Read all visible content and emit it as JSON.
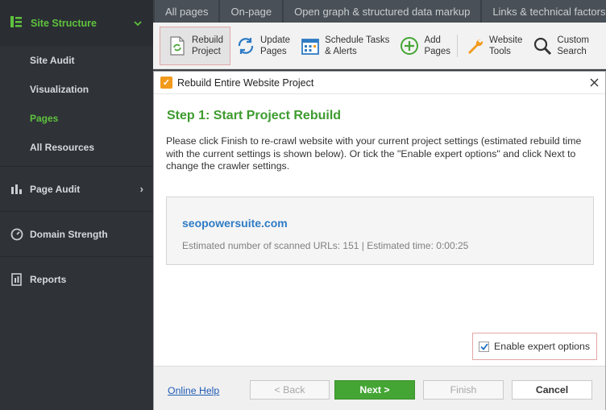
{
  "sidebar": {
    "header": {
      "label": "Site Structure",
      "icon": "site-structure-icon"
    },
    "sub_items": [
      {
        "label": "Site Audit",
        "active": false
      },
      {
        "label": "Visualization",
        "active": false
      },
      {
        "label": "Pages",
        "active": true
      },
      {
        "label": "All Resources",
        "active": false
      }
    ],
    "sections": [
      {
        "label": "Page Audit",
        "icon": "page-audit-icon",
        "has_arrow": true
      },
      {
        "label": "Domain Strength",
        "icon": "gauge-icon",
        "has_arrow": false
      },
      {
        "label": "Reports",
        "icon": "reports-icon",
        "has_arrow": false
      }
    ]
  },
  "tabs": [
    {
      "label": "All pages"
    },
    {
      "label": "On-page"
    },
    {
      "label": "Open graph & structured data markup"
    },
    {
      "label": "Links & technical factors"
    }
  ],
  "toolbar": {
    "rebuild": {
      "line1": "Rebuild",
      "line2": "Project"
    },
    "update": {
      "line1": "Update",
      "line2": "Pages"
    },
    "schedule": {
      "line1": "Schedule Tasks",
      "line2": "& Alerts"
    },
    "add": {
      "line1": "Add",
      "line2": "Pages"
    },
    "tools": {
      "line1": "Website",
      "line2": "Tools"
    },
    "search": {
      "line1": "Custom",
      "line2": "Search"
    }
  },
  "dialog": {
    "title": "Rebuild Entire Website Project",
    "step_title": "Step 1: Start Project Rebuild",
    "description": "Please click Finish to re-crawl website with your current project settings (estimated rebuild time with the current settings is shown below). Or tick the \"Enable expert options\" and click Next to change the crawler settings.",
    "site": "seopowersuite.com",
    "estimate": "Estimated number of scanned URLs: 151 | Estimated time: 0:00:25",
    "expert_label": "Enable expert options",
    "expert_checked": true,
    "help_link": "Online Help",
    "buttons": {
      "back": "< Back",
      "next": "Next >",
      "finish": "Finish",
      "cancel": "Cancel"
    }
  },
  "colors": {
    "accent_green": "#5fc23e",
    "step_green": "#3e9b2f",
    "link_blue": "#2e7bc4",
    "highlight_border": "#e2a7a7"
  }
}
